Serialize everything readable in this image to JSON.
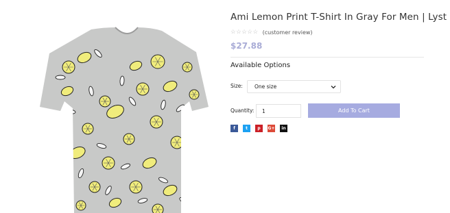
{
  "product": {
    "title": "Ami Lemon Print T-Shirt In Gray For Men | Lyst",
    "rating_stars": "☆☆☆☆☆",
    "review_text": "(customer review)",
    "price": "$27.88",
    "image_alt": "Ami Lemon Print T-Shirt"
  },
  "options": {
    "heading": "Available Options",
    "size_label": "Size:",
    "size_value": "One size",
    "quantity_label": "Quantity:",
    "quantity_value": "1",
    "add_to_cart_label": "Add To Cart"
  },
  "share": [
    {
      "icon": "facebook-icon",
      "glyph": "f",
      "color": "#3b5998"
    },
    {
      "icon": "twitter-icon",
      "glyph": "t",
      "color": "#1da1f2"
    },
    {
      "icon": "pinterest-icon",
      "glyph": "p",
      "color": "#cb2027"
    },
    {
      "icon": "google-plus-icon",
      "glyph": "G+",
      "color": "#dd4b39"
    },
    {
      "icon": "linkedin-icon",
      "glyph": "in",
      "color": "#111111"
    }
  ],
  "colors": {
    "price": "#a9acd6",
    "button": "#a6abe0",
    "shirt": "#c9cac9",
    "lemon": "#f0ec7c"
  }
}
